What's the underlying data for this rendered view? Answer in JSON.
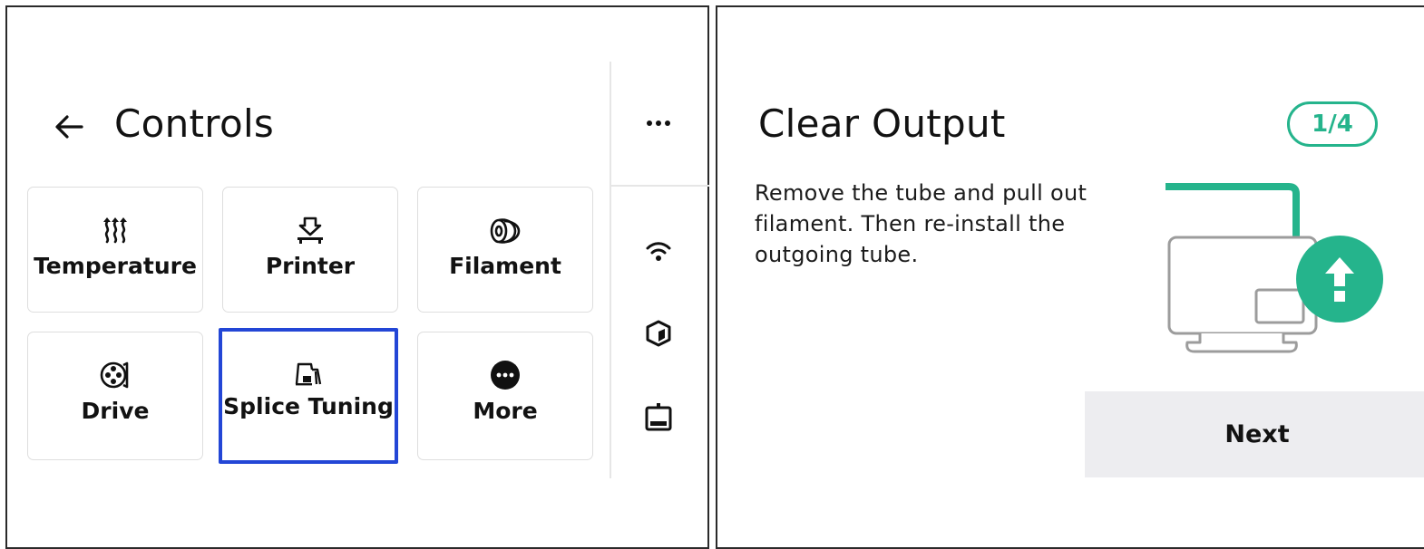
{
  "controls": {
    "title": "Controls",
    "tiles": [
      {
        "label": "Temperature",
        "icon": "heat-icon"
      },
      {
        "label": "Printer",
        "icon": "printer-icon"
      },
      {
        "label": "Filament",
        "icon": "filament-spool-icon"
      },
      {
        "label": "Drive",
        "icon": "drive-icon"
      },
      {
        "label": "Splice Tuning",
        "icon": "splice-tuning-icon",
        "selected": true
      },
      {
        "label": "More",
        "icon": "more-icon"
      }
    ],
    "side_icons": [
      "more-horizontal-icon",
      "wifi-icon",
      "cube-icon",
      "device-icon"
    ]
  },
  "wizard": {
    "title": "Clear Output",
    "step": "1/4",
    "instructions": "Remove the tube and pull out filament. Then re-install the outgoing tube.",
    "next_label": "Next"
  },
  "colors": {
    "accent_green": "#25b48c",
    "selected_outline": "#2346d6",
    "button_bg": "#ededf0"
  }
}
